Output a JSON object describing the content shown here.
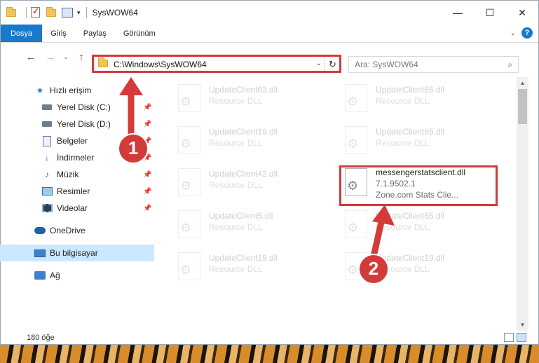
{
  "window": {
    "title": "SysWOW64",
    "controls": {
      "minimize": "—",
      "maximize": "☐",
      "close": "✕"
    }
  },
  "ribbon": {
    "tabs": [
      "Dosya",
      "Giriş",
      "Paylaş",
      "Görünüm"
    ],
    "expand_icon": "chevron-down-icon",
    "help": "?"
  },
  "nav": {
    "back": "←",
    "forward": "→",
    "recent": "⌄",
    "up": "↑",
    "address": "C:\\Windows\\SysWOW64",
    "refresh": "↻",
    "search_placeholder": "Ara: SysWOW64"
  },
  "sidebar": {
    "items": [
      {
        "label": "Hızlı erişim",
        "icon": "star-icon",
        "level": 1,
        "pinned": false
      },
      {
        "label": "Yerel Disk (C:)",
        "icon": "drive-icon",
        "level": 2,
        "pinned": true
      },
      {
        "label": "Yerel Disk (D:)",
        "icon": "drive-icon",
        "level": 2,
        "pinned": true
      },
      {
        "label": "Belgeler",
        "icon": "documents-icon",
        "level": 2,
        "pinned": true
      },
      {
        "label": "İndirmeler",
        "icon": "download-icon",
        "level": 2,
        "pinned": true
      },
      {
        "label": "Müzik",
        "icon": "music-icon",
        "level": 2,
        "pinned": true
      },
      {
        "label": "Resimler",
        "icon": "pictures-icon",
        "level": 2,
        "pinned": true
      },
      {
        "label": "Videolar",
        "icon": "videos-icon",
        "level": 2,
        "pinned": true
      },
      {
        "label": "OneDrive",
        "icon": "onedrive-icon",
        "level": 1,
        "pinned": false
      },
      {
        "label": "Bu bilgisayar",
        "icon": "this-pc-icon",
        "level": 1,
        "pinned": false,
        "selected": true
      },
      {
        "label": "Ağ",
        "icon": "network-icon",
        "level": 1,
        "pinned": false
      }
    ]
  },
  "files": [
    {
      "name": "UpdateClient63.dll",
      "sub": "Resource DLL"
    },
    {
      "name": "UpdateClient65.dll",
      "sub": "Resource DLL"
    },
    {
      "name": "UpdateClient19.dll",
      "sub": "Resource DLL"
    },
    {
      "name": "UpdateClient65.dll",
      "sub": "Resource DLL"
    },
    {
      "name": "UpdateClient42.dll",
      "sub": "Resource DLL"
    },
    {
      "name": "messengerstatsclient.dll",
      "sub": "7.1.9502.1",
      "sub2": "Zone.com Stats Clie..."
    },
    {
      "name": "UpdateClient5.dll",
      "sub": "Resource DLL"
    },
    {
      "name": "UpdateClient65.dll",
      "sub": "Resource DLL"
    },
    {
      "name": "UpdateClient19.dll",
      "sub": "Resource DLL"
    },
    {
      "name": "UpdateClient19.dll",
      "sub": "Resource DLL"
    }
  ],
  "annotations": {
    "step1": "1",
    "step2": "2",
    "color": "#d33a3a"
  },
  "status": {
    "count": "180 öğe"
  }
}
